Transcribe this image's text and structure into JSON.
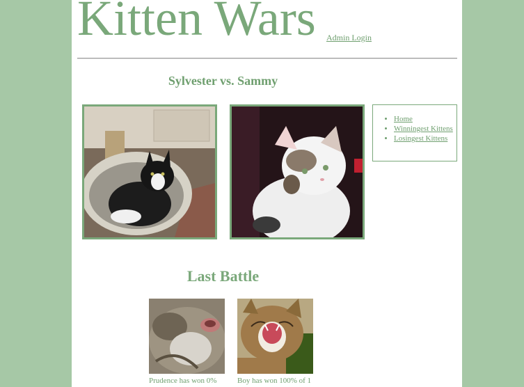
{
  "header": {
    "site_title": "Kitten Wars",
    "admin_link": "Admin Login"
  },
  "matchup": {
    "title": "Sylvester vs. Sammy",
    "left_kitten": "Sylvester",
    "right_kitten": "Sammy"
  },
  "nav": {
    "items": [
      {
        "label": "Home"
      },
      {
        "label": "Winningest Kittens"
      },
      {
        "label": "Losingest Kittens"
      }
    ]
  },
  "last_battle": {
    "title": "Last Battle",
    "left_caption": "Prudence has won 0%",
    "right_caption": "Boy has won 100% of 1"
  },
  "colors": {
    "background": "#a6c8a6",
    "accent": "#7aa87a",
    "link": "#6f9f6f"
  }
}
